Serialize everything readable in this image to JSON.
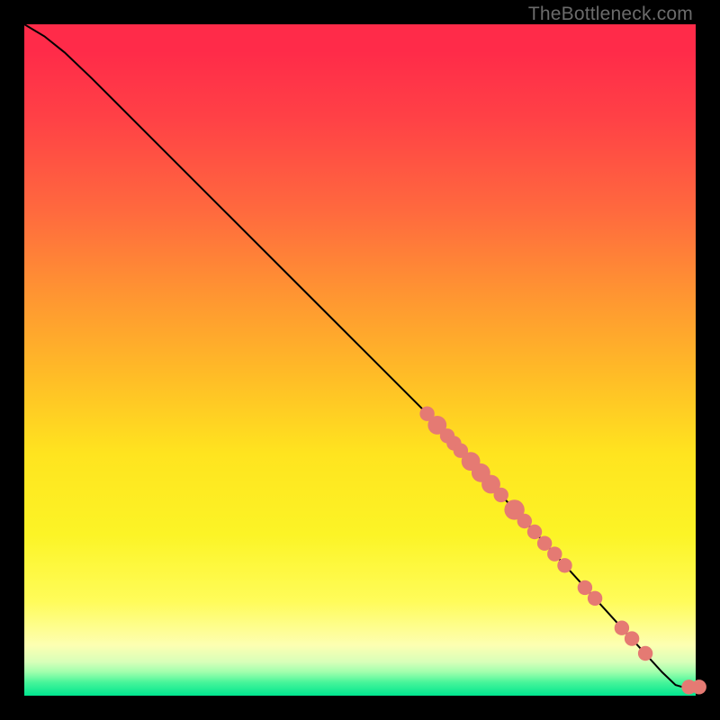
{
  "attribution": "TheBottleneck.com",
  "colors": {
    "dot": "#e57a73",
    "curve": "#000000",
    "page_bg": "#000000"
  },
  "chart_data": {
    "type": "line",
    "title": "",
    "xlabel": "",
    "ylabel": "",
    "xlim": [
      0,
      100
    ],
    "ylim": [
      0,
      100
    ],
    "grid": false,
    "legend": false,
    "curve": [
      {
        "x": 0,
        "y": 100
      },
      {
        "x": 3,
        "y": 98.2
      },
      {
        "x": 6,
        "y": 95.8
      },
      {
        "x": 10,
        "y": 92.0
      },
      {
        "x": 20,
        "y": 82.0
      },
      {
        "x": 30,
        "y": 72.0
      },
      {
        "x": 40,
        "y": 62.0
      },
      {
        "x": 50,
        "y": 52.0
      },
      {
        "x": 60,
        "y": 42.0
      },
      {
        "x": 70,
        "y": 31.0
      },
      {
        "x": 80,
        "y": 20.0
      },
      {
        "x": 90,
        "y": 9.0
      },
      {
        "x": 95,
        "y": 3.5
      },
      {
        "x": 97,
        "y": 1.6
      },
      {
        "x": 98,
        "y": 1.3
      },
      {
        "x": 100,
        "y": 1.3
      }
    ],
    "scatter": [
      {
        "x": 60.0,
        "y": 42.0,
        "r": 1.1
      },
      {
        "x": 61.5,
        "y": 40.3,
        "r": 1.4
      },
      {
        "x": 63.0,
        "y": 38.7,
        "r": 1.1
      },
      {
        "x": 64.0,
        "y": 37.6,
        "r": 1.1
      },
      {
        "x": 65.0,
        "y": 36.5,
        "r": 1.1
      },
      {
        "x": 66.5,
        "y": 34.9,
        "r": 1.4
      },
      {
        "x": 68.0,
        "y": 33.2,
        "r": 1.4
      },
      {
        "x": 69.5,
        "y": 31.5,
        "r": 1.4
      },
      {
        "x": 71.0,
        "y": 29.9,
        "r": 1.1
      },
      {
        "x": 73.0,
        "y": 27.7,
        "r": 1.5
      },
      {
        "x": 74.5,
        "y": 26.0,
        "r": 1.1
      },
      {
        "x": 76.0,
        "y": 24.4,
        "r": 1.1
      },
      {
        "x": 77.5,
        "y": 22.7,
        "r": 1.1
      },
      {
        "x": 79.0,
        "y": 21.1,
        "r": 1.1
      },
      {
        "x": 80.5,
        "y": 19.4,
        "r": 1.1
      },
      {
        "x": 83.5,
        "y": 16.1,
        "r": 1.1
      },
      {
        "x": 85.0,
        "y": 14.5,
        "r": 1.1
      },
      {
        "x": 89.0,
        "y": 10.1,
        "r": 1.1
      },
      {
        "x": 90.5,
        "y": 8.5,
        "r": 1.1
      },
      {
        "x": 92.5,
        "y": 6.3,
        "r": 1.1
      },
      {
        "x": 99.0,
        "y": 1.3,
        "r": 1.1
      },
      {
        "x": 100.5,
        "y": 1.3,
        "r": 1.1
      }
    ]
  }
}
